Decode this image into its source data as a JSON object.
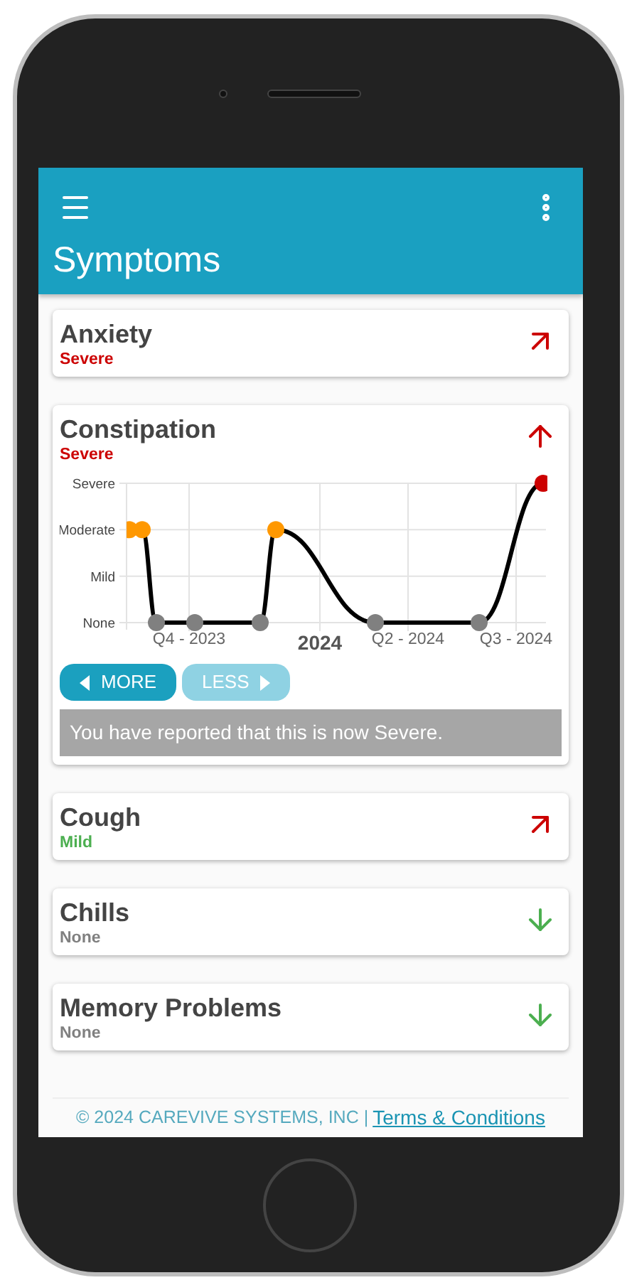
{
  "app_bar": {
    "title": "Symptoms"
  },
  "symptoms": [
    {
      "kind": "simple",
      "name": "Anxiety",
      "severity": "Severe",
      "color": "#cc0000",
      "trend": {
        "kind": "up_right"
      }
    },
    {
      "kind": "chart",
      "name": "Constipation",
      "severity": "Severe",
      "color": "#cc0000",
      "trend": {
        "kind": "up"
      },
      "chart": {
        "y_labels": [
          "Severe",
          "Moderate",
          "Mild",
          "None"
        ],
        "x_labels": [
          {
            "text": "Q4 - 2023",
            "emphasized": false
          },
          {
            "text": "2024",
            "emphasized": true
          },
          {
            "text": "Q2 - 2024",
            "emphasized": false
          },
          {
            "text": "Q3 - 2024",
            "emphasized": false
          }
        ]
      },
      "buttons": [
        {
          "label": "MORE",
          "disabled": false
        },
        {
          "label": "LESS",
          "disabled": true
        }
      ],
      "message": "You have reported that this is now Severe."
    },
    {
      "kind": "simple",
      "name": "Cough",
      "severity": "Mild",
      "color": "#4caf50",
      "trend": {
        "kind": "up_right"
      }
    },
    {
      "kind": "simple",
      "name": "Chills",
      "severity": "None",
      "color": "#808080",
      "trend": {
        "kind": "down"
      }
    },
    {
      "kind": "simple",
      "name": "Memory Problems",
      "severity": "None",
      "color": "#808080",
      "trend": {
        "kind": "down"
      }
    }
  ],
  "footer": {
    "text": "© 2024 CAREVIVE SYSTEMS, INC |",
    "link": "Terms & Conditions"
  }
}
